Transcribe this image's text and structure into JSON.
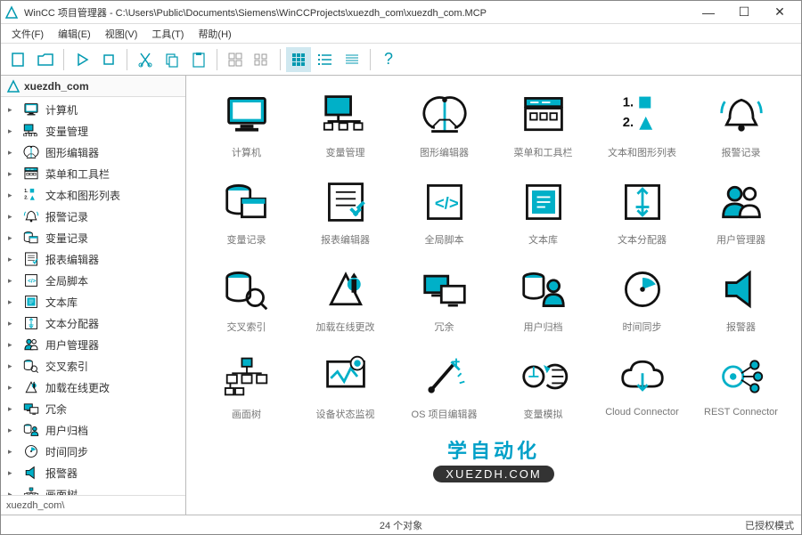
{
  "window": {
    "title": "WinCC 项目管理器 - C:\\Users\\Public\\Documents\\Siemens\\WinCCProjects\\xuezdh_com\\xuezdh_com.MCP",
    "minimize": "—",
    "maximize": "☐",
    "close": "✕"
  },
  "menu": {
    "file": "文件(F)",
    "edit": "编辑(E)",
    "view": "视图(V)",
    "tools": "工具(T)",
    "help": "帮助(H)"
  },
  "toolbar": {
    "help": "?"
  },
  "sidebar": {
    "project_name": "xuezdh_com",
    "footer": "xuezdh_com\\",
    "items": [
      {
        "label": "计算机",
        "svg": "computer"
      },
      {
        "label": "变量管理",
        "svg": "tags"
      },
      {
        "label": "图形编辑器",
        "svg": "graphics"
      },
      {
        "label": "菜单和工具栏",
        "svg": "menus"
      },
      {
        "label": "文本和图形列表",
        "svg": "textlist"
      },
      {
        "label": "报警记录",
        "svg": "alarm"
      },
      {
        "label": "变量记录",
        "svg": "taglog"
      },
      {
        "label": "报表编辑器",
        "svg": "report"
      },
      {
        "label": "全局脚本",
        "svg": "script"
      },
      {
        "label": "文本库",
        "svg": "textlib"
      },
      {
        "label": "文本分配器",
        "svg": "textdist"
      },
      {
        "label": "用户管理器",
        "svg": "user"
      },
      {
        "label": "交叉索引",
        "svg": "xref"
      },
      {
        "label": "加载在线更改",
        "svg": "loadonline"
      },
      {
        "label": "冗余",
        "svg": "redundant"
      },
      {
        "label": "用户归档",
        "svg": "userarch"
      },
      {
        "label": "时间同步",
        "svg": "timesync"
      },
      {
        "label": "报警器",
        "svg": "horn"
      },
      {
        "label": "画面树",
        "svg": "tree"
      }
    ]
  },
  "grid": {
    "items": [
      {
        "label": "计算机",
        "svg": "computer"
      },
      {
        "label": "变量管理",
        "svg": "tags"
      },
      {
        "label": "图形编辑器",
        "svg": "graphics"
      },
      {
        "label": "菜单和工具栏",
        "svg": "menus"
      },
      {
        "label": "文本和图形列表",
        "svg": "textlist"
      },
      {
        "label": "报警记录",
        "svg": "alarm"
      },
      {
        "label": "变量记录",
        "svg": "taglog"
      },
      {
        "label": "报表编辑器",
        "svg": "report"
      },
      {
        "label": "全局脚本",
        "svg": "script"
      },
      {
        "label": "文本库",
        "svg": "textlib"
      },
      {
        "label": "文本分配器",
        "svg": "textdist"
      },
      {
        "label": "用户管理器",
        "svg": "user"
      },
      {
        "label": "交叉索引",
        "svg": "xref"
      },
      {
        "label": "加载在线更改",
        "svg": "loadonline"
      },
      {
        "label": "冗余",
        "svg": "redundant"
      },
      {
        "label": "用户归档",
        "svg": "userarch"
      },
      {
        "label": "时间同步",
        "svg": "timesync"
      },
      {
        "label": "报警器",
        "svg": "horn"
      },
      {
        "label": "画面树",
        "svg": "tree"
      },
      {
        "label": "设备状态监视",
        "svg": "devstat"
      },
      {
        "label": "OS 项目编辑器",
        "svg": "oseditor"
      },
      {
        "label": "变量模拟",
        "svg": "tagsim"
      },
      {
        "label": "Cloud Connector",
        "svg": "cloud"
      },
      {
        "label": "REST Connector",
        "svg": "rest"
      }
    ]
  },
  "watermark": {
    "line1": "学自动化",
    "line2": "XUEZDH.COM"
  },
  "statusbar": {
    "objects": "24 个对象",
    "license": "已授权模式"
  }
}
